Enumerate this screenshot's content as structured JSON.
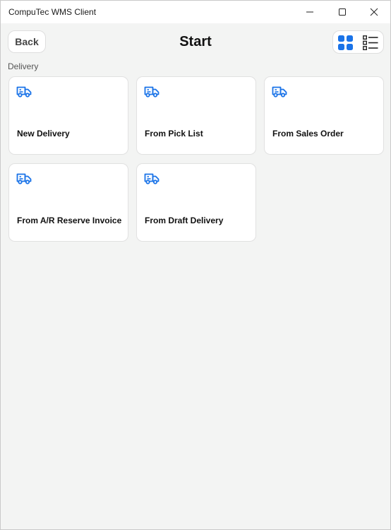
{
  "window": {
    "title": "CompuTec WMS Client"
  },
  "header": {
    "back_label": "Back",
    "title": "Start"
  },
  "section": {
    "label": "Delivery"
  },
  "tiles": [
    {
      "label": "New Delivery",
      "icon": "truck-icon"
    },
    {
      "label": "From Pick List",
      "icon": "truck-icon"
    },
    {
      "label": "From Sales Order",
      "icon": "truck-icon"
    },
    {
      "label": "From A/R Reserve Invoice",
      "icon": "truck-icon"
    },
    {
      "label": "From Draft Delivery",
      "icon": "truck-icon"
    }
  ],
  "colors": {
    "accent": "#1a73e8",
    "background": "#f3f4f3",
    "tile": "#ffffff"
  },
  "view_mode": "grid"
}
